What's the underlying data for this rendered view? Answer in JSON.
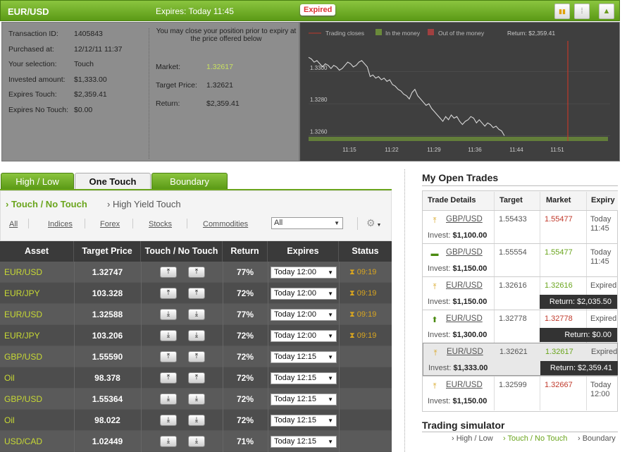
{
  "header": {
    "pair": "EUR/USD",
    "expires": "Expires:  Today 11:45",
    "status_badge": "Expired",
    "btn_chart": "▮▮",
    "btn_info": "⁞",
    "btn_collapse": "▲"
  },
  "transaction": {
    "labels": [
      "Transaction ID:",
      "Purchased at:",
      "Your selection:",
      "Invested amount:",
      "Expires Touch:",
      "Expires No Touch:"
    ],
    "values": [
      "1405843",
      "12/12/11 11:37",
      "Touch",
      "$1,333.00",
      "$2,359.41",
      "$0.00"
    ],
    "note": "You may close your position prior to expiry at the price offered below",
    "market_label": "Market:",
    "market_value": "1.32617",
    "target_label": "Target Price:",
    "target_value": "1.32621",
    "return_label": "Return:",
    "return_value": "$2,359.41"
  },
  "chart_data": {
    "type": "line",
    "legend": [
      "Trading closes",
      "In the money",
      "Out of the money"
    ],
    "return_text": "Return: $2,359.41",
    "x_ticks": [
      "11:15",
      "11:22",
      "11:29",
      "11:36",
      "11:44",
      "11:51"
    ],
    "y_ticks": [
      "1.3300",
      "1.3280",
      "1.3260"
    ],
    "ylim": [
      1.3258,
      1.3314
    ],
    "series": [
      {
        "x": [
          0,
          4,
          8,
          12,
          16,
          20,
          24,
          28,
          32,
          36,
          40,
          44,
          48,
          52,
          56,
          60,
          64,
          68,
          72,
          76,
          80,
          84,
          88,
          92,
          96,
          100,
          104,
          108,
          112,
          116,
          120,
          124,
          128,
          132,
          136,
          140,
          144,
          148,
          152,
          156,
          160,
          164,
          168,
          172,
          176,
          180,
          184,
          188,
          192,
          196,
          200,
          204,
          208,
          212,
          216,
          220,
          224,
          228,
          232,
          236,
          240,
          244,
          248,
          252,
          256,
          260,
          264,
          268,
          272,
          276,
          280
        ],
        "y": [
          1.3309,
          1.3308,
          1.3306,
          1.3307,
          1.3305,
          1.3303,
          1.3305,
          1.3304,
          1.3302,
          1.3304,
          1.3303,
          1.3301,
          1.3302,
          1.3304,
          1.3306,
          1.3305,
          1.3303,
          1.3304,
          1.3306,
          1.3307,
          1.3305,
          1.3303,
          1.3297,
          1.3298,
          1.3296,
          1.3297,
          1.3295,
          1.3296,
          1.3294,
          1.3295,
          1.3292,
          1.3291,
          1.3289,
          1.3288,
          1.3286,
          1.3285,
          1.3283,
          1.3287,
          1.3289,
          1.3285,
          1.3283,
          1.3281,
          1.3279,
          1.328,
          1.3277,
          1.3275,
          1.3273,
          1.3271,
          1.3269,
          1.3272,
          1.327,
          1.3273,
          1.3271,
          1.3272,
          1.3269,
          1.3267,
          1.3269,
          1.327,
          1.3272,
          1.3271,
          1.3268,
          1.327,
          1.3268,
          1.3266,
          1.3268,
          1.3267,
          1.3265,
          1.3266,
          1.3264,
          1.3263,
          1.326
        ]
      }
    ]
  },
  "tabs": [
    "High / Low",
    "One Touch",
    "Boundary"
  ],
  "subtabs": [
    "› Touch / No Touch",
    "› High Yield Touch"
  ],
  "filters": [
    "All",
    "Indices",
    "Forex",
    "Stocks",
    "Commodities"
  ],
  "filter_select": "All",
  "table": {
    "headers": [
      "Asset",
      "Target Price",
      "Touch / No Touch",
      "Return",
      "Expires",
      "Status"
    ],
    "rows": [
      {
        "asset": "EUR/USD",
        "price": "1.32747",
        "dir": "up",
        "ret": "77%",
        "exp": "Today 12:00",
        "status": "09:19"
      },
      {
        "asset": "EUR/JPY",
        "price": "103.328",
        "dir": "up",
        "ret": "72%",
        "exp": "Today 12:00",
        "status": "09:19"
      },
      {
        "asset": "EUR/USD",
        "price": "1.32588",
        "dir": "down",
        "ret": "77%",
        "exp": "Today 12:00",
        "status": "09:19"
      },
      {
        "asset": "EUR/JPY",
        "price": "103.206",
        "dir": "down",
        "ret": "72%",
        "exp": "Today 12:00",
        "status": "09:19"
      },
      {
        "asset": "GBP/USD",
        "price": "1.55590",
        "dir": "up",
        "ret": "72%",
        "exp": "Today 12:15",
        "status": ""
      },
      {
        "asset": "Oil",
        "price": "98.378",
        "dir": "up",
        "ret": "72%",
        "exp": "Today 12:15",
        "status": ""
      },
      {
        "asset": "GBP/USD",
        "price": "1.55364",
        "dir": "down",
        "ret": "72%",
        "exp": "Today 12:15",
        "status": ""
      },
      {
        "asset": "Oil",
        "price": "98.022",
        "dir": "down",
        "ret": "72%",
        "exp": "Today 12:15",
        "status": ""
      },
      {
        "asset": "USD/CAD",
        "price": "1.02449",
        "dir": "down",
        "ret": "71%",
        "exp": "Today 12:15",
        "status": ""
      }
    ]
  },
  "open_trades": {
    "title": "My Open Trades",
    "headers": [
      "Trade Details",
      "Target",
      "Market",
      "Expiry"
    ],
    "invest_label": "Invest:",
    "rows": [
      {
        "pair": "GBP/USD",
        "invest": "$1,100.00",
        "target": "1.55433",
        "market": "1.55477",
        "mcolor": "#c0392b",
        "expiry": "Today 11:45",
        "ret": "",
        "icon": "up-touch"
      },
      {
        "pair": "GBP/USD",
        "invest": "$1,150.00",
        "target": "1.55554",
        "market": "1.55477",
        "mcolor": "#6aa51d",
        "expiry": "Today 11:45",
        "ret": "",
        "icon": "no-touch"
      },
      {
        "pair": "EUR/USD",
        "invest": "$1,150.00",
        "target": "1.32616",
        "market": "1.32616",
        "mcolor": "#6aa51d",
        "expiry": "Expired",
        "ret": "Return: $2,035.50",
        "icon": "up-touch"
      },
      {
        "pair": "EUR/USD",
        "invest": "$1,300.00",
        "target": "1.32778",
        "market": "1.32778",
        "mcolor": "#c0392b",
        "expiry": "Expired",
        "ret": "Return: $0.00",
        "icon": "up-arrow"
      },
      {
        "pair": "EUR/USD",
        "invest": "$1,333.00",
        "target": "1.32621",
        "market": "1.32617",
        "mcolor": "#6aa51d",
        "expiry": "Expired",
        "ret": "Return: $2,359.41",
        "icon": "up-touch"
      },
      {
        "pair": "EUR/USD",
        "invest": "$1,150.00",
        "target": "1.32599",
        "market": "1.32667",
        "mcolor": "#c0392b",
        "expiry": "Today 12:00",
        "ret": "",
        "icon": "up-touch"
      }
    ]
  },
  "simulator": {
    "title": "Trading simulator",
    "links": [
      "› High / Low",
      "› Touch / No Touch",
      "› Boundary"
    ]
  },
  "colors": {
    "accent": "#6aa51d",
    "asset": "#c8d934",
    "loss": "#c0392b",
    "status": "#d8a520"
  }
}
